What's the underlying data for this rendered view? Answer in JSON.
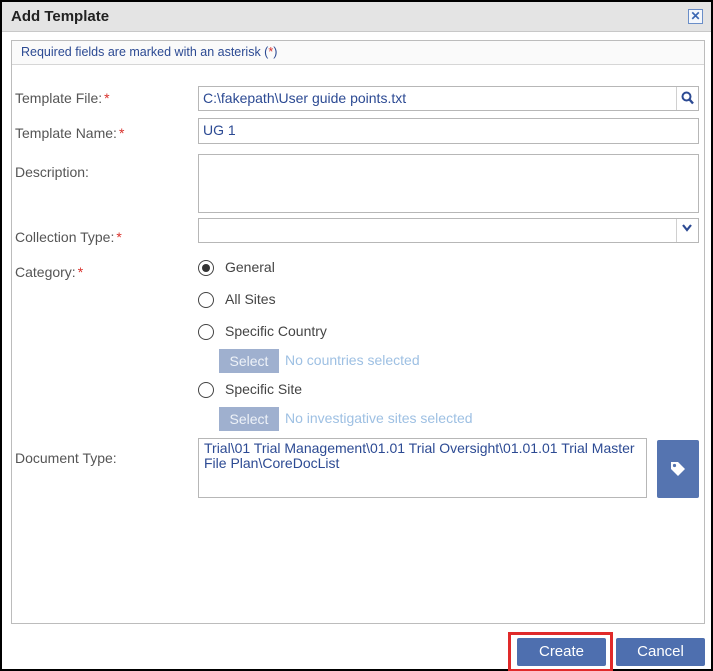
{
  "dialog": {
    "title": "Add Template",
    "close_icon": "close-x-icon"
  },
  "form": {
    "required_note_prefix": "Required fields are marked with an asterisk (",
    "required_note_star": "*",
    "required_note_suffix": ")",
    "template_file": {
      "label": "Template File:",
      "required_mark": "*",
      "value": "C:\\fakepath\\User guide points.txt",
      "icon": "search-icon"
    },
    "template_name": {
      "label": "Template Name:",
      "required_mark": "*",
      "value": "UG 1"
    },
    "description": {
      "label": "Description:",
      "value": ""
    },
    "collection_type": {
      "label": "Collection Type:",
      "required_mark": "*",
      "value": "",
      "icon": "chevron-down-icon"
    },
    "category": {
      "label": "Category:",
      "required_mark": "*",
      "options": [
        {
          "label": "General",
          "checked": true
        },
        {
          "label": "All Sites",
          "checked": false
        },
        {
          "label": "Specific Country",
          "checked": false
        },
        {
          "label": "Specific Site",
          "checked": false
        }
      ],
      "country_select_label": "Select",
      "country_select_info": "No countries selected",
      "site_select_label": "Select",
      "site_select_info": "No investigative sites selected"
    },
    "document_type": {
      "label": "Document Type:",
      "value": "Trial\\01 Trial Management\\01.01 Trial Oversight\\01.01.01 Trial Master File Plan\\CoreDocList",
      "icon": "tag-icon"
    }
  },
  "footer": {
    "create_label": "Create",
    "cancel_label": "Cancel"
  },
  "colors": {
    "accent": "#4e6faf",
    "required": "#d9302b",
    "highlight": "#e02a2a",
    "disabled_button": "#9fb0cf"
  }
}
